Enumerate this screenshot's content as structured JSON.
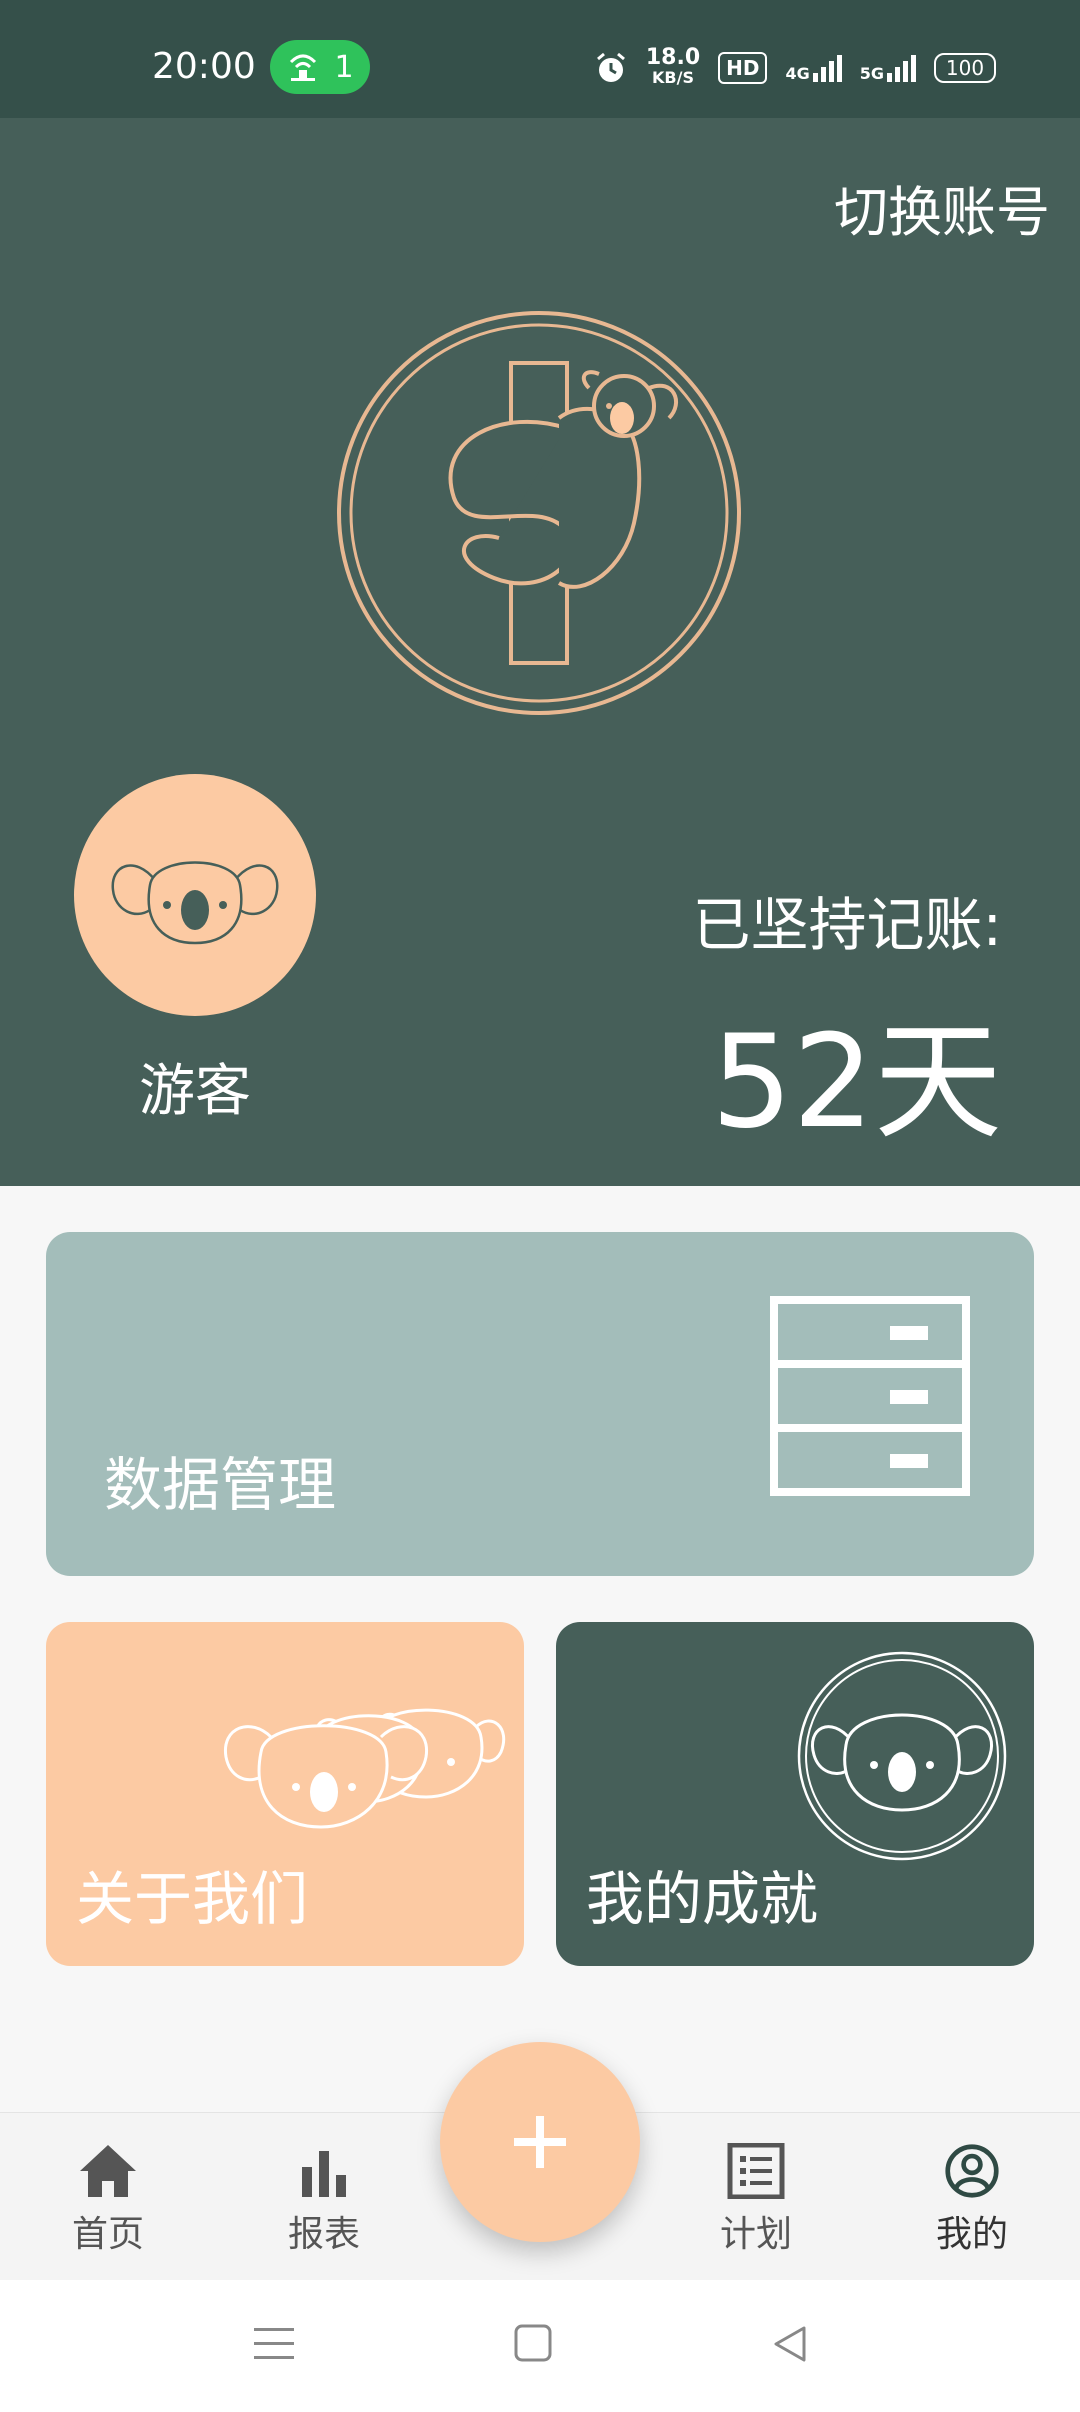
{
  "status_bar": {
    "time": "20:00",
    "hotspot_count": "1",
    "net_speed_value": "18.0",
    "net_speed_unit": "KB/S",
    "hd_badge": "HD",
    "signal_1": "4G",
    "signal_2": "5G",
    "battery": "100"
  },
  "header": {
    "switch_account": "切换账号",
    "user_name": "游客",
    "streak_label": "已坚持记账:",
    "streak_value": "52天"
  },
  "cards": {
    "data_management": "数据管理",
    "about_us": "关于我们",
    "achievements": "我的成就"
  },
  "bottom_nav": {
    "items": [
      {
        "label": "首页",
        "icon": "home-icon"
      },
      {
        "label": "报表",
        "icon": "bar-chart-icon"
      },
      {
        "label": "计划",
        "icon": "list-icon"
      },
      {
        "label": "我的",
        "icon": "profile-icon"
      }
    ],
    "active_index": 3
  },
  "colors": {
    "primary": "#465f59",
    "status_bar": "#35504a",
    "accent": "#fccaa3",
    "data_card": "#a3bdba"
  }
}
